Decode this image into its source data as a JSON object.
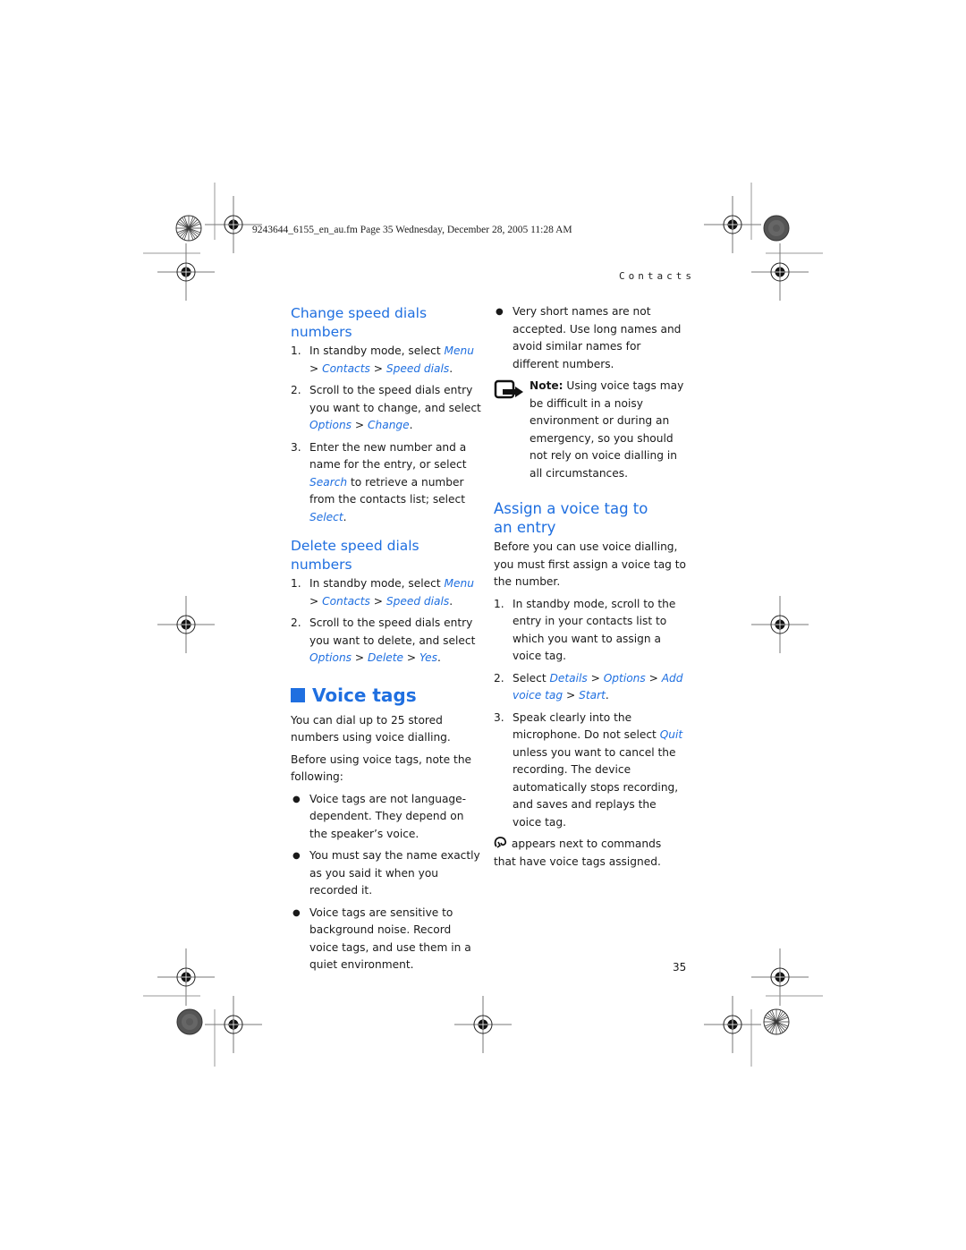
{
  "header": {
    "file_info": "9243644_6155_en_au.fm  Page 35  Wednesday, December 28, 2005  11:28 AM",
    "running_title": "Contacts",
    "page_number": "35"
  },
  "left_column": {
    "change_speed_dials": {
      "title": "Change speed dials numbers",
      "steps": [
        {
          "num": "1.",
          "parts": [
            {
              "t": "In standby mode, select "
            },
            {
              "ui": "Menu"
            },
            {
              "t": " > "
            },
            {
              "ui": "Contacts"
            },
            {
              "t": " > "
            },
            {
              "ui": "Speed dials"
            },
            {
              "t": "."
            }
          ]
        },
        {
          "num": "2.",
          "parts": [
            {
              "t": "Scroll to the speed dials entry you want to change, and select "
            },
            {
              "ui": "Options"
            },
            {
              "t": " > "
            },
            {
              "ui": "Change"
            },
            {
              "t": "."
            }
          ]
        },
        {
          "num": "3.",
          "parts": [
            {
              "t": "Enter the new number and a name for the entry, or select "
            },
            {
              "ui": "Search"
            },
            {
              "t": " to retrieve a number from the contacts list; select "
            },
            {
              "ui": "Select"
            },
            {
              "t": "."
            }
          ]
        }
      ]
    },
    "delete_speed_dials": {
      "title": "Delete speed dials numbers",
      "steps": [
        {
          "num": "1.",
          "parts": [
            {
              "t": "In standby mode, select "
            },
            {
              "ui": "Menu"
            },
            {
              "t": " > "
            },
            {
              "ui": "Contacts"
            },
            {
              "t": " > "
            },
            {
              "ui": "Speed dials"
            },
            {
              "t": "."
            }
          ]
        },
        {
          "num": "2.",
          "parts": [
            {
              "t": "Scroll to the speed dials entry you want to delete, and select "
            },
            {
              "ui": "Options"
            },
            {
              "t": " > "
            },
            {
              "ui": "Delete"
            },
            {
              "t": " > "
            },
            {
              "ui": "Yes"
            },
            {
              "t": "."
            }
          ]
        }
      ]
    },
    "voice_tags": {
      "title": "Voice tags",
      "intro": "You can dial up to 25 stored numbers using voice dialling.",
      "before": "Before using voice tags, note the following:",
      "bullets": [
        "Voice tags are not language-dependent. They depend on the speaker’s voice.",
        "You must say the name exactly as you said it when you recorded it.",
        "Voice tags are sensitive to background noise. Record voice tags, and use them in a quiet environment."
      ]
    }
  },
  "right_column": {
    "bullet": "Very short names are not accepted. Use long names and avoid similar names for different numbers.",
    "note": {
      "label": "Note:",
      "text": " Using voice tags may be difficult in a noisy environment or during an emergency, so you should not rely on voice dialling in all circumstances."
    },
    "assign": {
      "title_line1": "Assign a voice tag to",
      "title_line2": "an entry",
      "intro": "Before you can use voice dialling, you must first assign a voice tag to the number.",
      "steps": [
        {
          "num": "1.",
          "parts": [
            {
              "t": "In standby mode, scroll to the entry in your contacts list to which you want to assign a voice tag."
            }
          ]
        },
        {
          "num": "2.",
          "parts": [
            {
              "t": "Select "
            },
            {
              "ui": "Details"
            },
            {
              "t": " > "
            },
            {
              "ui": "Options"
            },
            {
              "t": " > "
            },
            {
              "ui": "Add voice tag"
            },
            {
              "t": " > "
            },
            {
              "ui": "Start"
            },
            {
              "t": "."
            }
          ]
        },
        {
          "num": "3.",
          "parts": [
            {
              "t": "Speak clearly into the microphone. Do not select "
            },
            {
              "ui": "Quit"
            },
            {
              "t": " unless you want to cancel the recording. The device automatically stops recording, and saves and replays the voice tag."
            }
          ]
        }
      ],
      "footer": " appears next to commands that have voice tags assigned.",
      "footer_icon": "voice-tag-icon"
    }
  },
  "colors": {
    "accent": "#1f6fe0",
    "text": "#1a1a1a"
  }
}
